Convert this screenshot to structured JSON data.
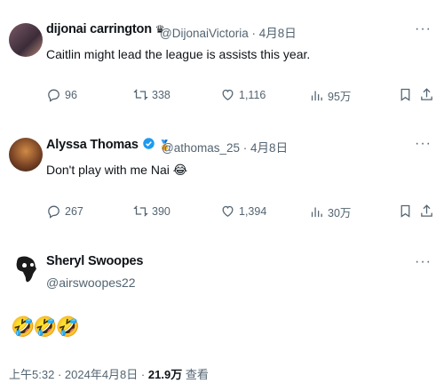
{
  "tweets": [
    {
      "name": "dijonai carrington",
      "name_badge": "♛",
      "handle": "@DijonaiVictoria",
      "dot": "·",
      "date": "4月8日",
      "text": "Caitlin might lead the league is assists this year.",
      "more": "···",
      "replies": "96",
      "retweets": "338",
      "likes": "1,116",
      "views": "95万"
    },
    {
      "name": "Alyssa Thomas",
      "name_badge": "🏅",
      "handle": "@athomas_25",
      "dot": "·",
      "date": "4月8日",
      "text": "Don't play with me Nai 😂",
      "more": "···",
      "replies": "267",
      "retweets": "390",
      "likes": "1,394",
      "views": "30万"
    }
  ],
  "main_tweet": {
    "name": "Sheryl Swoopes",
    "handle": "@airswoopes22",
    "more": "···",
    "text": "🤣🤣🤣"
  },
  "footer": {
    "time": "上午5:32",
    "dot1": "·",
    "date": "2024年4月8日",
    "dot2": "·",
    "views": "21.9万",
    "views_label": "查看"
  },
  "icons": {
    "reply": "reply-icon",
    "retweet": "retweet-icon",
    "like": "heart-icon",
    "views": "views-bar-icon",
    "bookmark": "bookmark-icon",
    "share": "share-icon",
    "verified": "verified-badge-icon"
  },
  "colors": {
    "text": "#0f1419",
    "secondary": "#536471",
    "verified": "#1d9bf0"
  }
}
